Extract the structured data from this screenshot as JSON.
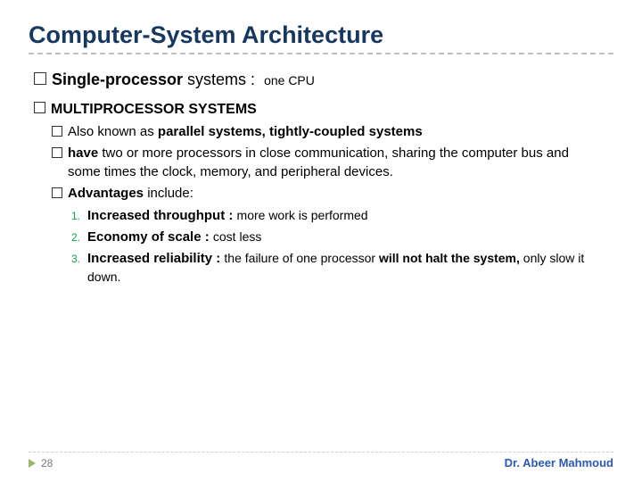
{
  "title": "Computer-System Architecture",
  "single": {
    "label_bold1": "Single-processor ",
    "label_plain": "systems : ",
    "desc": "one CPU"
  },
  "multi": {
    "heading": "MULTIPROCESSOR SYSTEMS",
    "items": [
      {
        "pre": "Also ",
        "mid": "known as ",
        "bold": "parallel systems, tightly-coupled systems",
        "post": ""
      },
      {
        "pre": "",
        "mid": "",
        "bold": "have ",
        "post_plain": "two or more processors in close communication, sharing the computer bus and some times the clock, memory, and peripheral devices."
      },
      {
        "pre": "",
        "mid": "",
        "bold": "Advantages ",
        "post_plain": "include:"
      }
    ],
    "adv": [
      {
        "n": "1.",
        "b1": "Increased throughput : ",
        "t1": "more work is performed"
      },
      {
        "n": "2.",
        "b1": "Economy of scale : ",
        "t1": "cost less"
      },
      {
        "n": "3.",
        "b1": "Increased reliability  : ",
        "t1": "the failure of one processor ",
        "b2": "will not halt the system, ",
        "t2": "only slow it down."
      }
    ]
  },
  "footer": {
    "page": "28",
    "author": "Dr. Abeer Mahmoud"
  }
}
